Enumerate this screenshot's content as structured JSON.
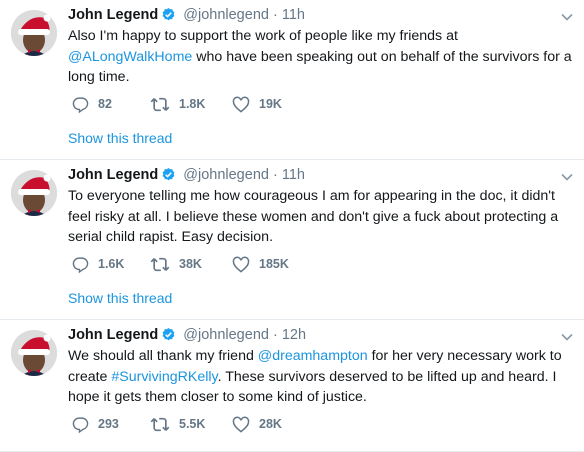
{
  "tweets": [
    {
      "name": "John Legend",
      "handle": "@johnlegend",
      "dot": "·",
      "time": "11h",
      "text_parts": [
        "Also I'm happy to support the work of people like my friends at ",
        "@ALongWalkHome",
        " who have been speaking out on behalf of the survivors for a long time."
      ],
      "replies": "82",
      "retweets": "1.8K",
      "likes": "19K",
      "show_thread": "Show this thread"
    },
    {
      "name": "John Legend",
      "handle": "@johnlegend",
      "dot": "·",
      "time": "11h",
      "text_parts": [
        "To everyone telling me how courageous I am for appearing in the doc, it didn't feel risky at all. I believe these women and don't give a fuck about protecting a serial child rapist. Easy decision."
      ],
      "replies": "1.6K",
      "retweets": "38K",
      "likes": "185K",
      "show_thread": "Show this thread"
    },
    {
      "name": "John Legend",
      "handle": "@johnlegend",
      "dot": "·",
      "time": "12h",
      "text_parts": [
        "We should all thank my friend ",
        "@dreamhampton",
        " for her very necessary work to create ",
        "#SurvivingRKelly",
        ".  These survivors deserved to be lifted up and heard. I hope it gets them closer to some kind of justice."
      ],
      "replies": "293",
      "retweets": "5.5K",
      "likes": "28K"
    }
  ],
  "colors": {
    "link": "#1b95e0",
    "muted": "#657786",
    "text": "#14171a",
    "divider": "#e6ecf0",
    "verified": "#1da1f2"
  },
  "icons": [
    "chevron-down-icon",
    "verified-icon",
    "reply-icon",
    "retweet-icon",
    "like-icon",
    "avatar-santa-hat"
  ]
}
